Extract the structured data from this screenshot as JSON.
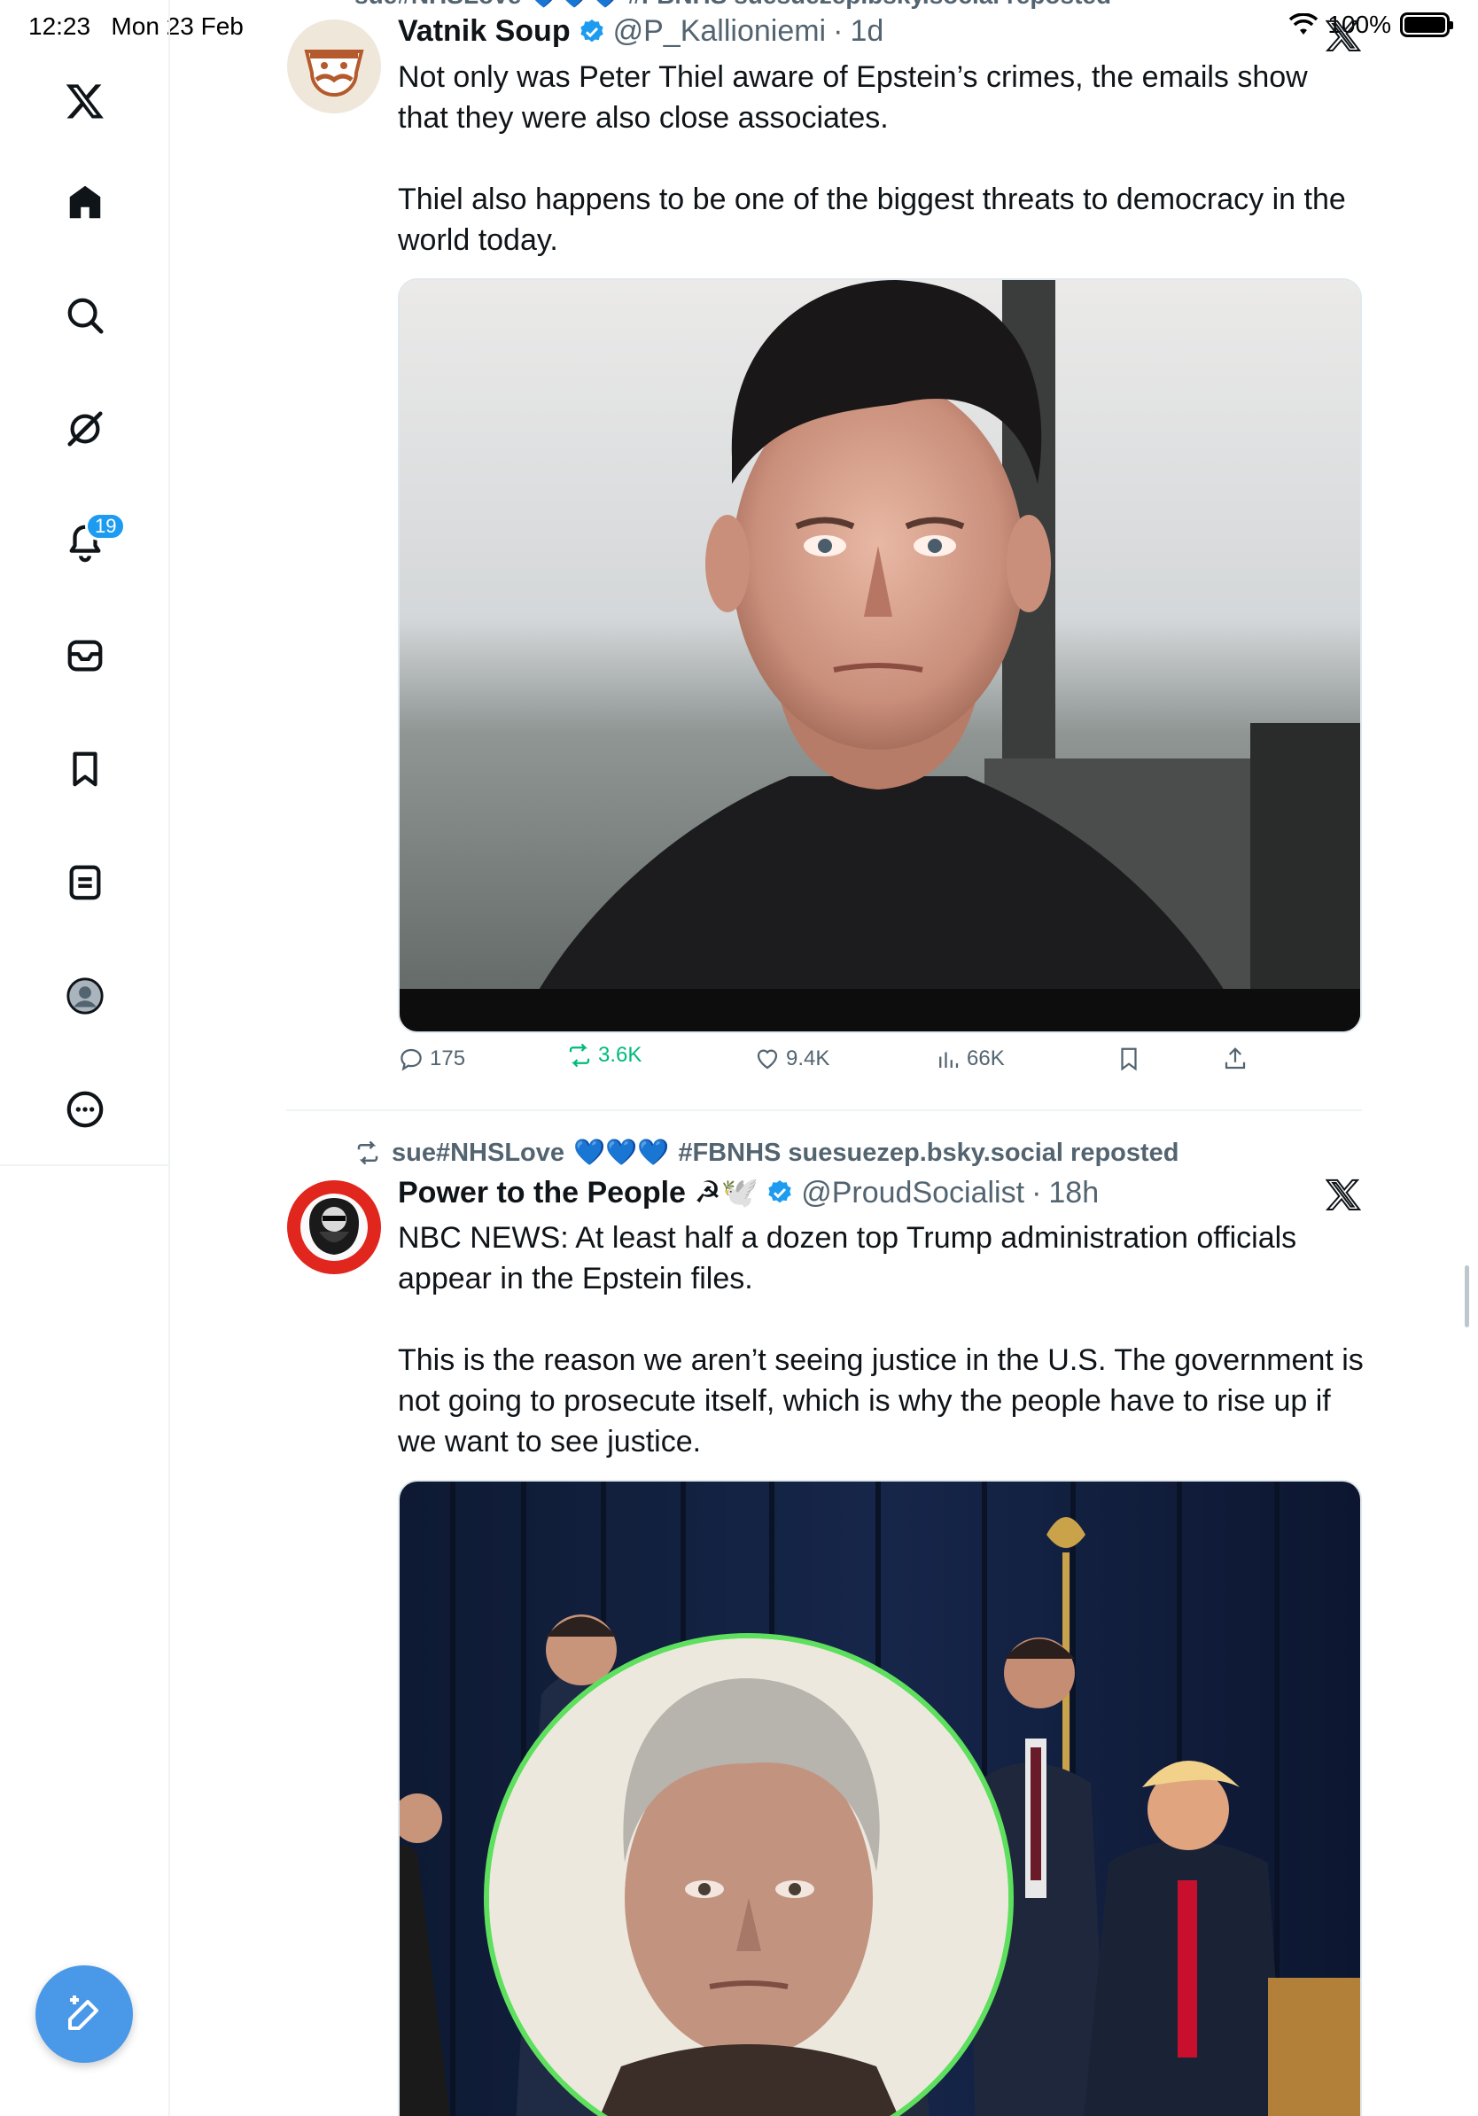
{
  "status_bar": {
    "time": "12:23",
    "date": "Mon 23 Feb",
    "battery": "100%"
  },
  "sidebar": {
    "items": [
      {
        "icon": "x-logo-icon"
      },
      {
        "icon": "home-icon"
      },
      {
        "icon": "search-icon"
      },
      {
        "icon": "grok-icon"
      },
      {
        "icon": "notifications-icon",
        "badge": "19"
      },
      {
        "icon": "messages-icon"
      },
      {
        "icon": "bookmarks-icon"
      },
      {
        "icon": "lists-icon"
      },
      {
        "icon": "profile-icon"
      },
      {
        "icon": "more-icon"
      }
    ],
    "compose_icon": "compose-icon"
  },
  "feed": {
    "top_repost_partial": "sue#NHSLove 💙💙💙 #FBNHS suesuezep.bsky.social reposted",
    "tweets": [
      {
        "display_name": "Vatnik Soup",
        "handle": "@P_Kallioniemi",
        "dot": "·",
        "time": "1d",
        "text": "Not only was Peter Thiel aware of Epstein’s crimes, the emails show that they were also close associates.\n\nThiel also happens to be one of the biggest threats to democracy in the world today.",
        "media_description": "man in black shirt in front of window",
        "actions": {
          "replies": "175",
          "reposts": "3.6K",
          "likes": "9.4K",
          "views": "66K"
        }
      },
      {
        "repost_user": "sue#NHSLove",
        "repost_hearts": "💙💙💙",
        "repost_tail": "#FBNHS suesuezep.bsky.social reposted",
        "display_name": "Power to the People ☭🕊️",
        "handle": "@ProudSocialist",
        "dot": "·",
        "time": "18h",
        "text": "NBC NEWS: At least half a dozen top Trump administration officials appear in the Epstein files.\n\nThis is the reason we aren’t seeing justice in the U.S. The government is not going to prosecute itself, which is why the people have to rise up if we want to see justice.",
        "media_description": "officials at a signing with inset portrait"
      }
    ]
  },
  "colors": {
    "accent": "#1d9bf0",
    "repost_green": "#00ba7c",
    "muted": "#536471",
    "compose": "#4a99e9"
  }
}
